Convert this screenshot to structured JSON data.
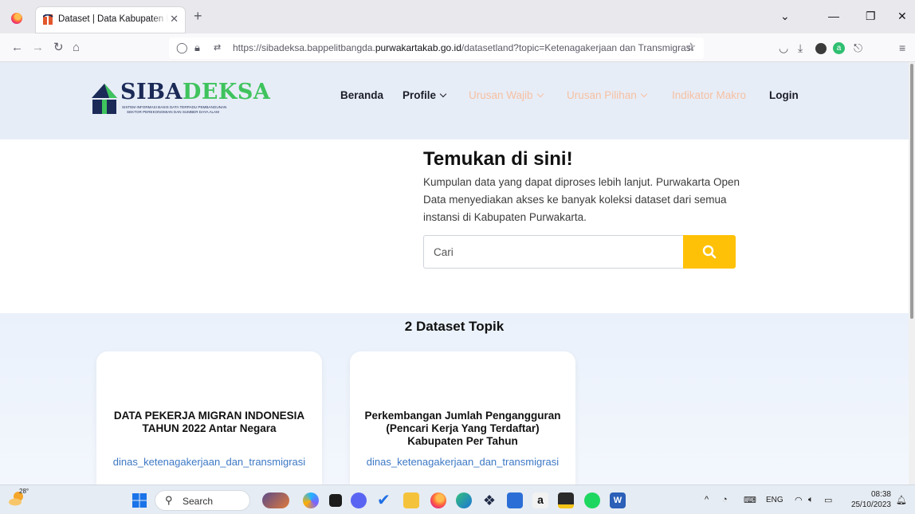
{
  "browser": {
    "tab_title": "Dataset | Data Kabupaten Purwakarta",
    "url_prefix": "https://sibadeksa.bappelitbangda.",
    "url_domain": "purwakartakab.go.id",
    "url_path": "/datasetland?topic=Ketenagakerjaan dan Transmigrasi"
  },
  "site": {
    "logo_main_a": "SIBA",
    "logo_main_b": "DEKSA",
    "logo_sub_1": "Sistem Informasi Basis Data Terpadu Pembangunan",
    "logo_sub_2": "Sektor Perekonomian dan Sumber Daya Alam",
    "nav": {
      "beranda": "Beranda",
      "profile": "Profile",
      "urusan_wajib": "Urusan Wajib",
      "urusan_pilihan": "Urusan Pilihan",
      "indikator_makro": "Indikator Makro",
      "login": "Login"
    }
  },
  "hero": {
    "title": "Temukan di sini!",
    "description": "Kumpulan data yang dapat diproses lebih lanjut. Purwakarta Open Data menyediakan akses ke banyak koleksi dataset dari semua instansi di Kabupaten Purwakarta.",
    "search_placeholder": "Cari"
  },
  "datasets": {
    "heading": "2 Dataset Topik",
    "items": [
      {
        "title": "DATA PEKERJA MIGRAN INDONESIA TAHUN 2022 Antar Negara",
        "agency": "dinas_ketenagakerjaan_dan_transmigrasi"
      },
      {
        "title": "Perkembangan Jumlah Pengangguran (Pencari Kerja Yang Terdaftar) Kabupaten Per Tahun",
        "agency": "dinas_ketenagakerjaan_dan_transmigrasi"
      }
    ]
  },
  "taskbar": {
    "weather_temp": "28°",
    "search_label": "Search",
    "lang": "ENG",
    "time": "08:38",
    "date": "25/10/2023"
  },
  "colors": {
    "accent": "#ffc107",
    "brand_navy": "#1b2a57",
    "brand_green": "#3fc35d",
    "link": "#3d78c5",
    "muted_nav": "#f6c0a2"
  }
}
